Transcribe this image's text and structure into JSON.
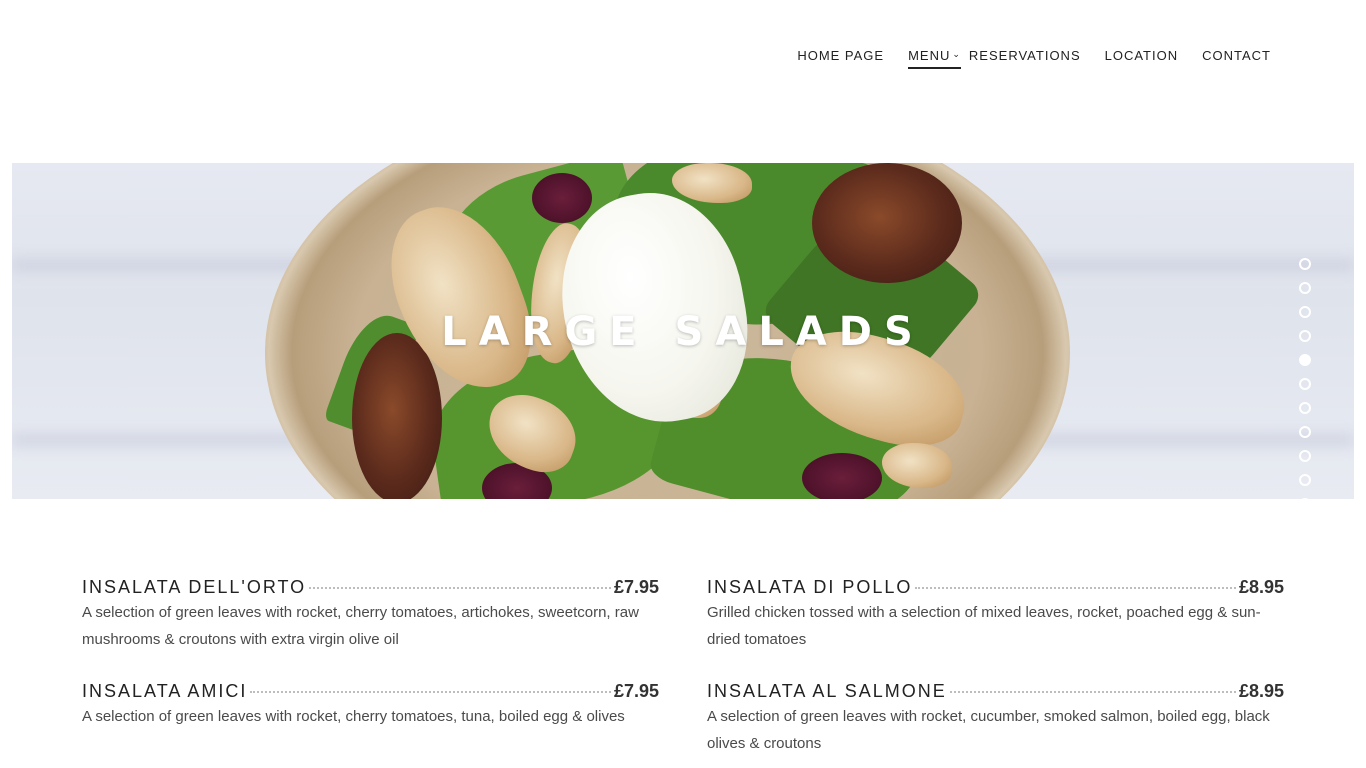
{
  "nav": {
    "items": [
      {
        "label": "HOME PAGE"
      },
      {
        "label": "MENU"
      },
      {
        "label": "RESERVATIONS"
      },
      {
        "label": "LOCATION"
      },
      {
        "label": "CONTACT"
      }
    ],
    "active": "MENU"
  },
  "hero": {
    "title": "LARGE SALADS",
    "slide_count": 11,
    "active_slide": 5
  },
  "menu": {
    "left": [
      {
        "name": "INSALATA DELL'ORTO",
        "price": "£7.95",
        "description": "A selection of green leaves with rocket, cherry tomatoes, artichokes, sweetcorn, raw mushrooms & croutons with extra virgin olive oil"
      },
      {
        "name": "INSALATA AMICI",
        "price": "£7.95",
        "description": "A selection of green leaves with rocket, cherry tomatoes, tuna, boiled egg & olives"
      }
    ],
    "right": [
      {
        "name": "INSALATA DI POLLO",
        "price": "£8.95",
        "description": "Grilled chicken tossed with a selection of mixed leaves, rocket, poached egg & sun-dried tomatoes"
      },
      {
        "name": "INSALATA AL SALMONE",
        "price": "£8.95",
        "description": "A selection of green leaves with rocket, cucumber, smoked salmon, boiled egg, black olives & croutons"
      }
    ]
  }
}
